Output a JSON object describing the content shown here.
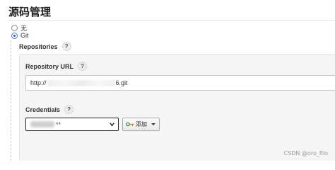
{
  "section": {
    "title": "源码管理"
  },
  "scm_options": [
    {
      "label": "无",
      "selected": false
    },
    {
      "label": "Git",
      "selected": true
    }
  ],
  "repositories": {
    "label": "Repositories",
    "help": "?"
  },
  "repository_url": {
    "label": "Repository URL",
    "help": "?",
    "value_prefix": "http://",
    "value_suffix": "6.git"
  },
  "credentials": {
    "label": "Credentials",
    "help": "?",
    "selected_masked": "**",
    "add_button_label": "添加"
  },
  "watermark": "CSDN @oro_filo",
  "colors": {
    "accent": "#2a62b8",
    "select_border": "#222222",
    "panel_bg": "#f5f5f5"
  }
}
